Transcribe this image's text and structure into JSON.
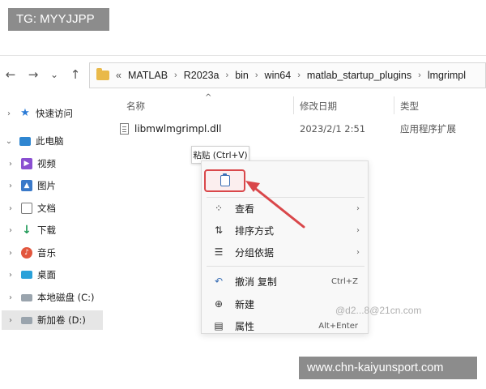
{
  "badges": {
    "top_left": "TG: MYYJJPP",
    "bottom_right": "www.chn-kaiyunsport.com"
  },
  "nav": {
    "back": "←",
    "forward": "→",
    "recent": "⌄",
    "up": "↑"
  },
  "address": {
    "overflow": "«",
    "crumbs": [
      "MATLAB",
      "R2023a",
      "bin",
      "win64",
      "matlab_startup_plugins",
      "lmgrimpl"
    ]
  },
  "columns": {
    "name": "名称",
    "date": "修改日期",
    "type": "类型"
  },
  "files": [
    {
      "name": "libmwlmgrimpl.dll",
      "date": "2023/2/1 2:51",
      "type": "应用程序扩展"
    }
  ],
  "sidebar": {
    "items": [
      {
        "label": "快速访问",
        "icon": "star-icon"
      },
      {
        "label": "此电脑",
        "icon": "computer-icon"
      },
      {
        "label": "视频",
        "icon": "video-icon"
      },
      {
        "label": "图片",
        "icon": "pictures-icon"
      },
      {
        "label": "文档",
        "icon": "document-icon"
      },
      {
        "label": "下载",
        "icon": "download-icon"
      },
      {
        "label": "音乐",
        "icon": "music-icon"
      },
      {
        "label": "桌面",
        "icon": "desktop-icon"
      },
      {
        "label": "本地磁盘 (C:)",
        "icon": "drive-icon"
      },
      {
        "label": "新加卷 (D:)",
        "icon": "drive-icon"
      }
    ]
  },
  "tooltip": "粘贴 (Ctrl+V)",
  "context_menu": {
    "items": [
      {
        "label": "查看",
        "icon": "grid-icon"
      },
      {
        "label": "排序方式",
        "icon": "sort-icon"
      },
      {
        "label": "分组依据",
        "icon": "group-icon"
      },
      {
        "label": "撤消 复制",
        "icon": "undo-icon",
        "shortcut": "Ctrl+Z"
      },
      {
        "label": "新建",
        "icon": "new-icon"
      },
      {
        "label": "属性",
        "icon": "properties-icon",
        "shortcut": "Alt+Enter"
      }
    ]
  },
  "watermark": "@d2...8@21cn.com",
  "colors": {
    "highlight_red": "#d9474a",
    "folder": "#e9b949"
  }
}
